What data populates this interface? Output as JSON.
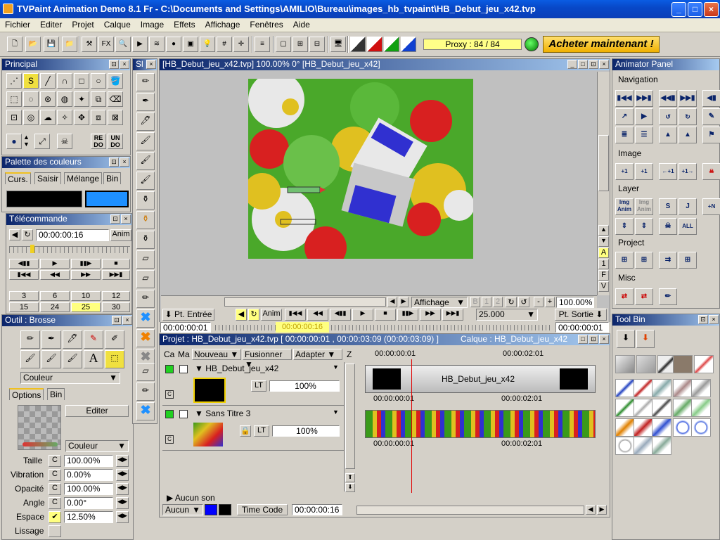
{
  "window": {
    "title": "TVPaint Animation Demo 8.1 Fr - C:\\Documents and Settings\\AMILIO\\Bureau\\images_hb_tvpaint\\HB_Debut_jeu_x42.tvp"
  },
  "menu": [
    "Fichier",
    "Editer",
    "Projet",
    "Calque",
    "Image",
    "Effets",
    "Affichage",
    "Fenêtres",
    "Aide"
  ],
  "toolbar": {
    "fx_label": "FX",
    "proxy": "Proxy : 84 / 84",
    "buy": "Acheter maintenant !"
  },
  "principal": {
    "title": "Principal",
    "redo": "RE DO",
    "undo": "UN DO"
  },
  "palette": {
    "title": "Palette des couleurs",
    "tabs": [
      "Curs.",
      "Saisir",
      "Mélange",
      "Bin"
    ],
    "main_color": "#000000",
    "bg_color": "#1e90ff"
  },
  "remote": {
    "title": "Télécommande",
    "timecode": "00:00:00:16",
    "anim": "Anim",
    "fps_row1": [
      "3",
      "6",
      "10",
      "12"
    ],
    "fps_row2": [
      "15",
      "24",
      "25",
      "30"
    ]
  },
  "brush": {
    "title": "Outil : Brosse",
    "mode": "Couleur",
    "tabs": [
      "Options",
      "Bin"
    ],
    "edit": "Editer",
    "mode2": "Couleur",
    "params": [
      {
        "label": "Taille",
        "value": "100.00%"
      },
      {
        "label": "Vibration",
        "value": "0.00%"
      },
      {
        "label": "Opacité",
        "value": "100.00%"
      },
      {
        "label": "Angle",
        "value": "0.00°"
      },
      {
        "label": "Espace",
        "value": "12.50%"
      },
      {
        "label": "Lissage",
        "value": ""
      }
    ],
    "c": "C"
  },
  "sidebar": {
    "title": "Sl"
  },
  "canvas": {
    "title": "[HB_Debut_jeu_x42.tvp]  100.00%   0°  [HB_Debut_jeu_x42]",
    "display": "Affichage",
    "zoom": "100.00%",
    "side": [
      "A",
      "1",
      "F",
      "V"
    ],
    "minus": "-",
    "plus": "+"
  },
  "transport": {
    "in": "Pt. Entrée",
    "anim": "Anim",
    "fps": "25.000",
    "out": "Pt. Sortie",
    "tc_start": "00:00:00:01",
    "tc_mid": "00:00:00:16",
    "tc_end": "00:00:00:01"
  },
  "timeline": {
    "title": "Projet : HB_Debut_jeu_x42.tvp [ 00:00:00:01 , 00:00:03:09  (00:00:03:09) ]",
    "layer_title": "Calque : HB_Debut_jeu_x42",
    "cols": [
      "Ca",
      "Ma",
      "Nouveau",
      "Fusionner",
      "Adapter",
      "Z"
    ],
    "ruler": [
      "00:00:00:01",
      "00:00:02:01"
    ],
    "layers": [
      {
        "name": "HB_Debut_jeu_x42",
        "opacity": "100%",
        "lt": "LT",
        "clip": "HB_Debut_jeu_x42",
        "tc_a": "00:00:00:01",
        "tc_b": "00:00:02:01"
      },
      {
        "name": "Sans Titre 3",
        "opacity": "100%",
        "lt": "LT",
        "tc_a": "00:00:00:01",
        "tc_b": "00:00:02:01"
      }
    ],
    "sound": "Aucun son",
    "none": "Aucun",
    "timecode_btn": "Time Code",
    "tc": "00:00:00:16"
  },
  "animator": {
    "title": "Animator Panel",
    "sections": [
      "Navigation",
      "Image",
      "Layer",
      "Project",
      "Misc"
    ],
    "img_anim": "Img Anim"
  },
  "toolbin": {
    "title": "Tool Bin"
  }
}
